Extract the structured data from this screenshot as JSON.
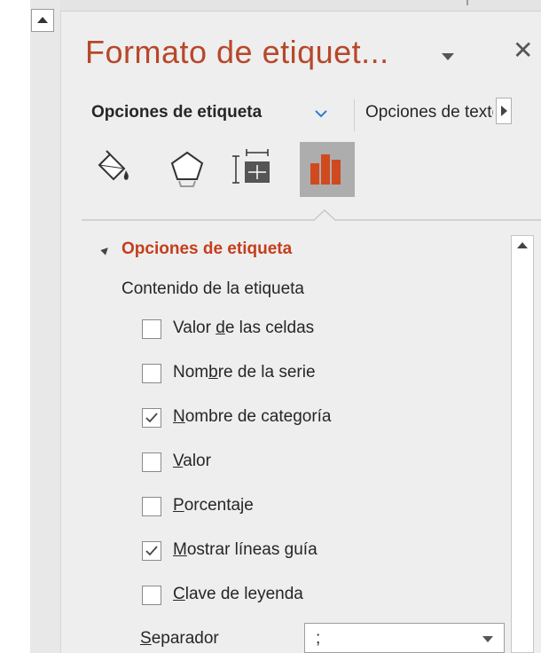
{
  "pane": {
    "title": "Formato de etiquet...",
    "menu_icon": "dropdown-triangle-icon",
    "close_icon": "close-icon",
    "close_glyph": "✕"
  },
  "tabs": {
    "active_label": "Opciones de etiqueta",
    "other_label": "Opciones de texto",
    "scroll_icon": "chevron-right-icon"
  },
  "icons": [
    {
      "name": "fill-line-icon",
      "selected": false
    },
    {
      "name": "effects-icon",
      "selected": false
    },
    {
      "name": "size-properties-icon",
      "selected": false
    },
    {
      "name": "label-options-icon",
      "selected": true
    }
  ],
  "section": {
    "title": "Opciones de etiqueta",
    "subtitle": "Contenido de la etiqueta"
  },
  "checkboxes": [
    {
      "pre": "Valor ",
      "key": "d",
      "post": "e las celdas",
      "checked": false
    },
    {
      "pre": "Nom",
      "key": "b",
      "post": "re de la serie",
      "checked": false
    },
    {
      "pre": "",
      "key": "N",
      "post": "ombre de categoría",
      "checked": true
    },
    {
      "pre": "",
      "key": "V",
      "post": "alor",
      "checked": false
    },
    {
      "pre": "",
      "key": "P",
      "post": "orcentaje",
      "checked": false
    },
    {
      "pre": "",
      "key": "M",
      "post": "ostrar líneas guía",
      "checked": true
    },
    {
      "pre": "",
      "key": "C",
      "post": "lave de leyenda",
      "checked": false
    }
  ],
  "separator": {
    "label_key": "S",
    "label_rest": "eparador",
    "value": ";"
  },
  "colors": {
    "accent": "#b7472a",
    "section_title": "#c43e1c",
    "tab_chevron": "#2b7cd3",
    "selected_icon_bg": "#adadad"
  }
}
